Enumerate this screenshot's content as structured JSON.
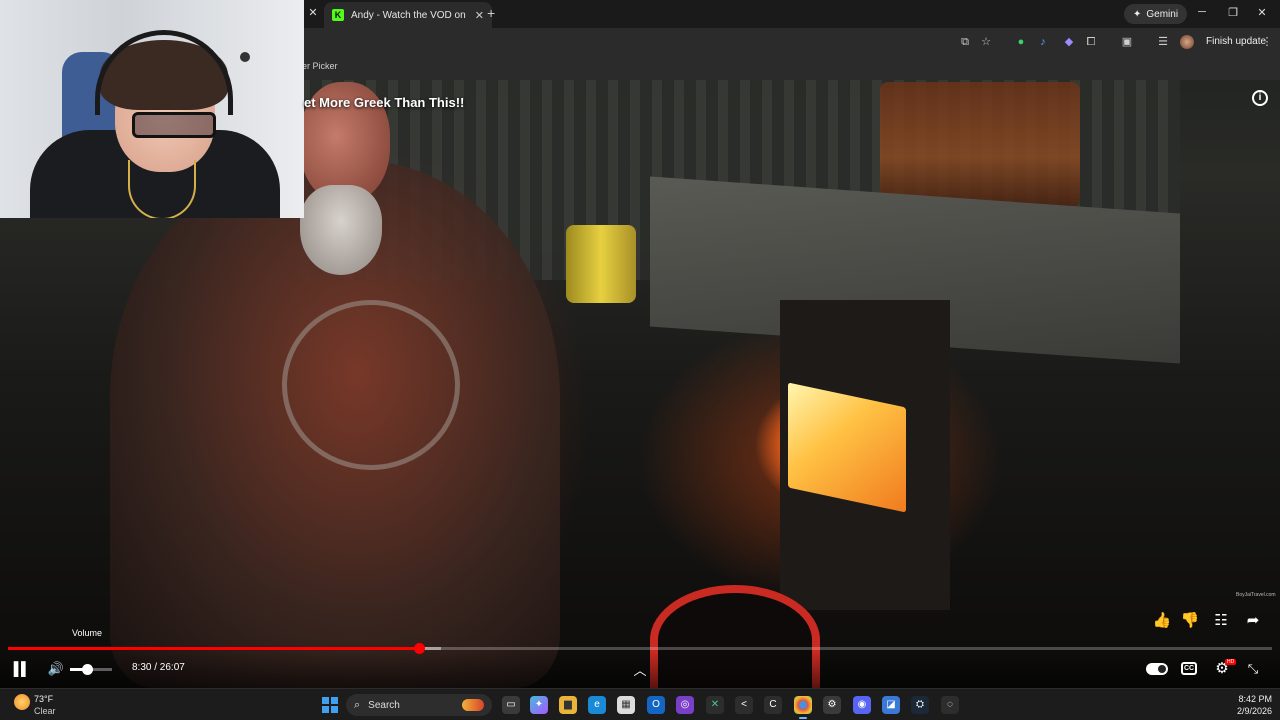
{
  "browser": {
    "active_tab_title": "Andy - Watch the VOD on Kick",
    "new_tab_glyph": "+",
    "gemini_label": "Gemini",
    "finish_update_label": "Finish update",
    "bookmark_fragment": "er Picker"
  },
  "video": {
    "title": "et More Greek Than This!!",
    "watermark": "BoyJaiTravel.com",
    "volume_tooltip": "Volume",
    "current_time": "8:30",
    "duration": "26:07",
    "time_display": "8:30 / 26:07",
    "progress_fraction": 0.3255,
    "buffer_fraction": 0.3425,
    "volume_fraction": 0.4,
    "autoplay_on": true,
    "accent_color": "#ff0000"
  },
  "icons": {
    "info": "info-icon",
    "like": "thumbs-up-icon",
    "dislike": "thumbs-down-icon",
    "comments": "comment-icon",
    "share": "share-icon",
    "pause": "pause-icon",
    "volume": "volume-icon",
    "chevron": "chevron-up-icon",
    "captions": "cc-icon",
    "settings": "gear-icon",
    "fullscreen_exit": "exit-fullscreen-icon"
  },
  "cc_label": "CC",
  "hd_badge": "HD",
  "taskbar": {
    "weather_temp": "73°F",
    "weather_desc": "Clear",
    "search_label": "Search",
    "time": "8:42 PM",
    "date": "2/9/2026"
  }
}
